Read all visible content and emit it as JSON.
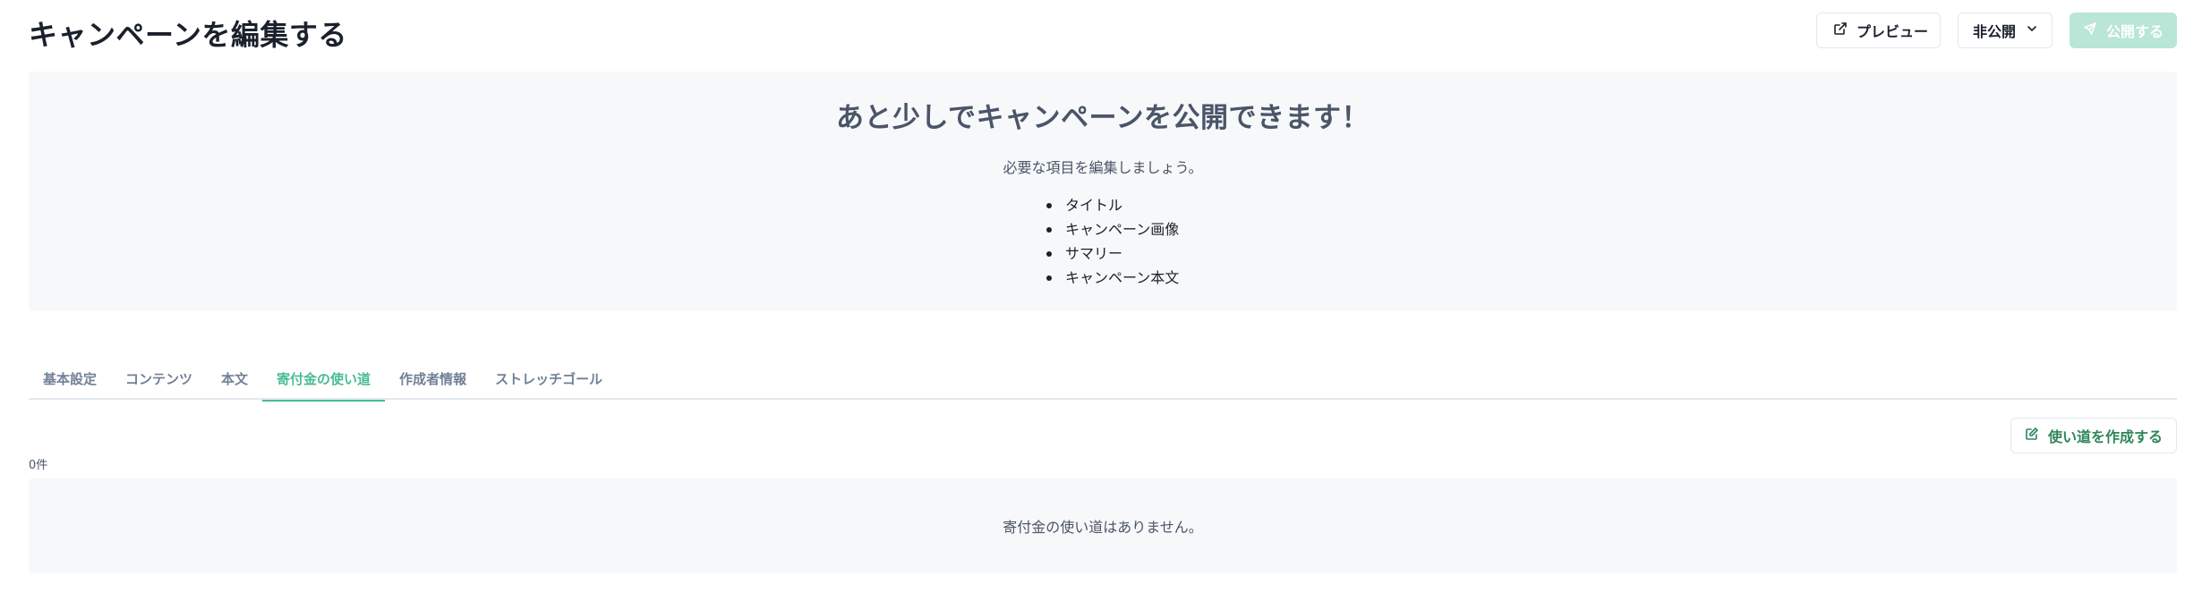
{
  "header": {
    "title": "キャンペーンを編集する",
    "preview_label": "プレビュー",
    "visibility_label": "非公開",
    "publish_label": "公開する"
  },
  "notice": {
    "title": "あと少しでキャンペーンを公開できます！",
    "subtitle": "必要な項目を編集しましょう。",
    "items": [
      "タイトル",
      "キャンペーン画像",
      "サマリー",
      "キャンペーン本文"
    ]
  },
  "tabs": [
    {
      "label": "基本設定",
      "active": false
    },
    {
      "label": "コンテンツ",
      "active": false
    },
    {
      "label": "本文",
      "active": false
    },
    {
      "label": "寄付金の使い道",
      "active": true
    },
    {
      "label": "作成者情報",
      "active": false
    },
    {
      "label": "ストレッチゴール",
      "active": false
    }
  ],
  "content": {
    "create_label": "使い道を作成する",
    "count_label": "0件",
    "empty_message": "寄付金の使い道はありません。"
  },
  "colors": {
    "accent": "#48bb93",
    "publish_disabled": "#b9e6d6",
    "panel_bg": "#f7f8fa"
  }
}
